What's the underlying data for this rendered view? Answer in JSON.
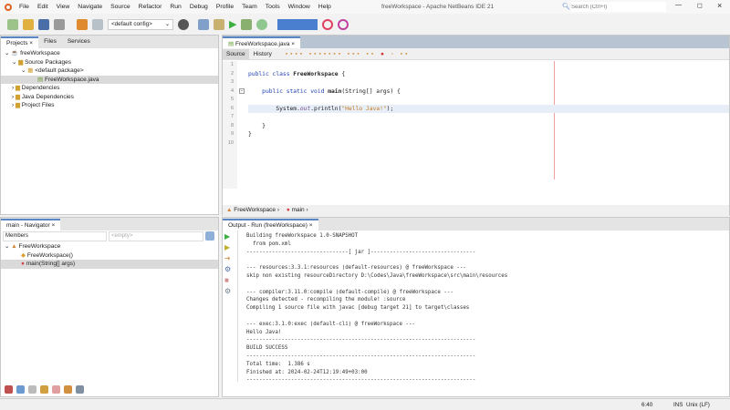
{
  "window": {
    "title": "freeWorkspace - Apache NetBeans IDE 21",
    "search_placeholder": "Search (Ctrl+I)"
  },
  "menu": [
    "File",
    "Edit",
    "View",
    "Navigate",
    "Source",
    "Refactor",
    "Run",
    "Debug",
    "Profile",
    "Team",
    "Tools",
    "Window",
    "Help"
  ],
  "toolbar": {
    "config": "<default config>"
  },
  "projects": {
    "tabs": [
      "Projects",
      "Files",
      "Services"
    ],
    "tree": [
      "freeWorkspace",
      "Source Packages",
      "<default package>",
      "FreeWorkspace.java",
      "Dependencies",
      "Java Dependencies",
      "Project Files"
    ]
  },
  "navigator": {
    "title": "main - Navigator",
    "filter": "Members",
    "filter2": "<empty>",
    "tree": [
      "FreeWorkspace",
      "FreeWorkspace()",
      "main(String[] args)"
    ]
  },
  "editor": {
    "tab": "FreeWorkspace.java",
    "source_tab": "Source",
    "history_tab": "History",
    "lines": [
      "1",
      "2",
      "3",
      "4",
      "5",
      "6",
      "7",
      "8",
      "9",
      "10"
    ],
    "code": {
      "l2a": "public class ",
      "l2b": "FreeWorkspace",
      " l2c": " {",
      "l4a": "    public static void ",
      "l4b": "main",
      "l4c": "(String[] args) {",
      "l6a": "        System.",
      "l6b": "out",
      "l6c": ".println(",
      "l6d": "\"Hello Java!\"",
      "l6e": ");",
      "l8": "    }",
      "l9": "}"
    },
    "breadcrumb": [
      "FreeWorkspace",
      "main"
    ]
  },
  "output": {
    "tab": "Output - Run (freeWorkspace)",
    "lines": [
      "Building freeWorkspace 1.0-SNAPSHOT",
      "  from pom.xml",
      "--------------------------------[ jar ]---------------------------------",
      "",
      "--- resources:3.3.1:resources (default-resources) @ freeWorkspace ---",
      "skip non existing resourceDirectory D:\\Codes\\Java\\freeWorkspace\\src\\main\\resources",
      "",
      "--- compiler:3.11.0:compile (default-compile) @ freeWorkspace ---",
      "Changes detected - recompiling the module! :source",
      "Compiling 1 source file with javac [debug target 21] to target\\classes",
      "",
      "--- exec:3.1.0:exec (default-cli) @ freeWorkspace ---",
      "Hello Java!",
      "------------------------------------------------------------------------",
      "BUILD SUCCESS",
      "------------------------------------------------------------------------",
      "Total time:  1.386 s",
      "Finished at: 2024-02-24T12:19:49+03:00",
      "------------------------------------------------------------------------"
    ]
  },
  "status": {
    "position": "6:40",
    "mode": "INS",
    "line_ending": "Unix (LF)"
  }
}
